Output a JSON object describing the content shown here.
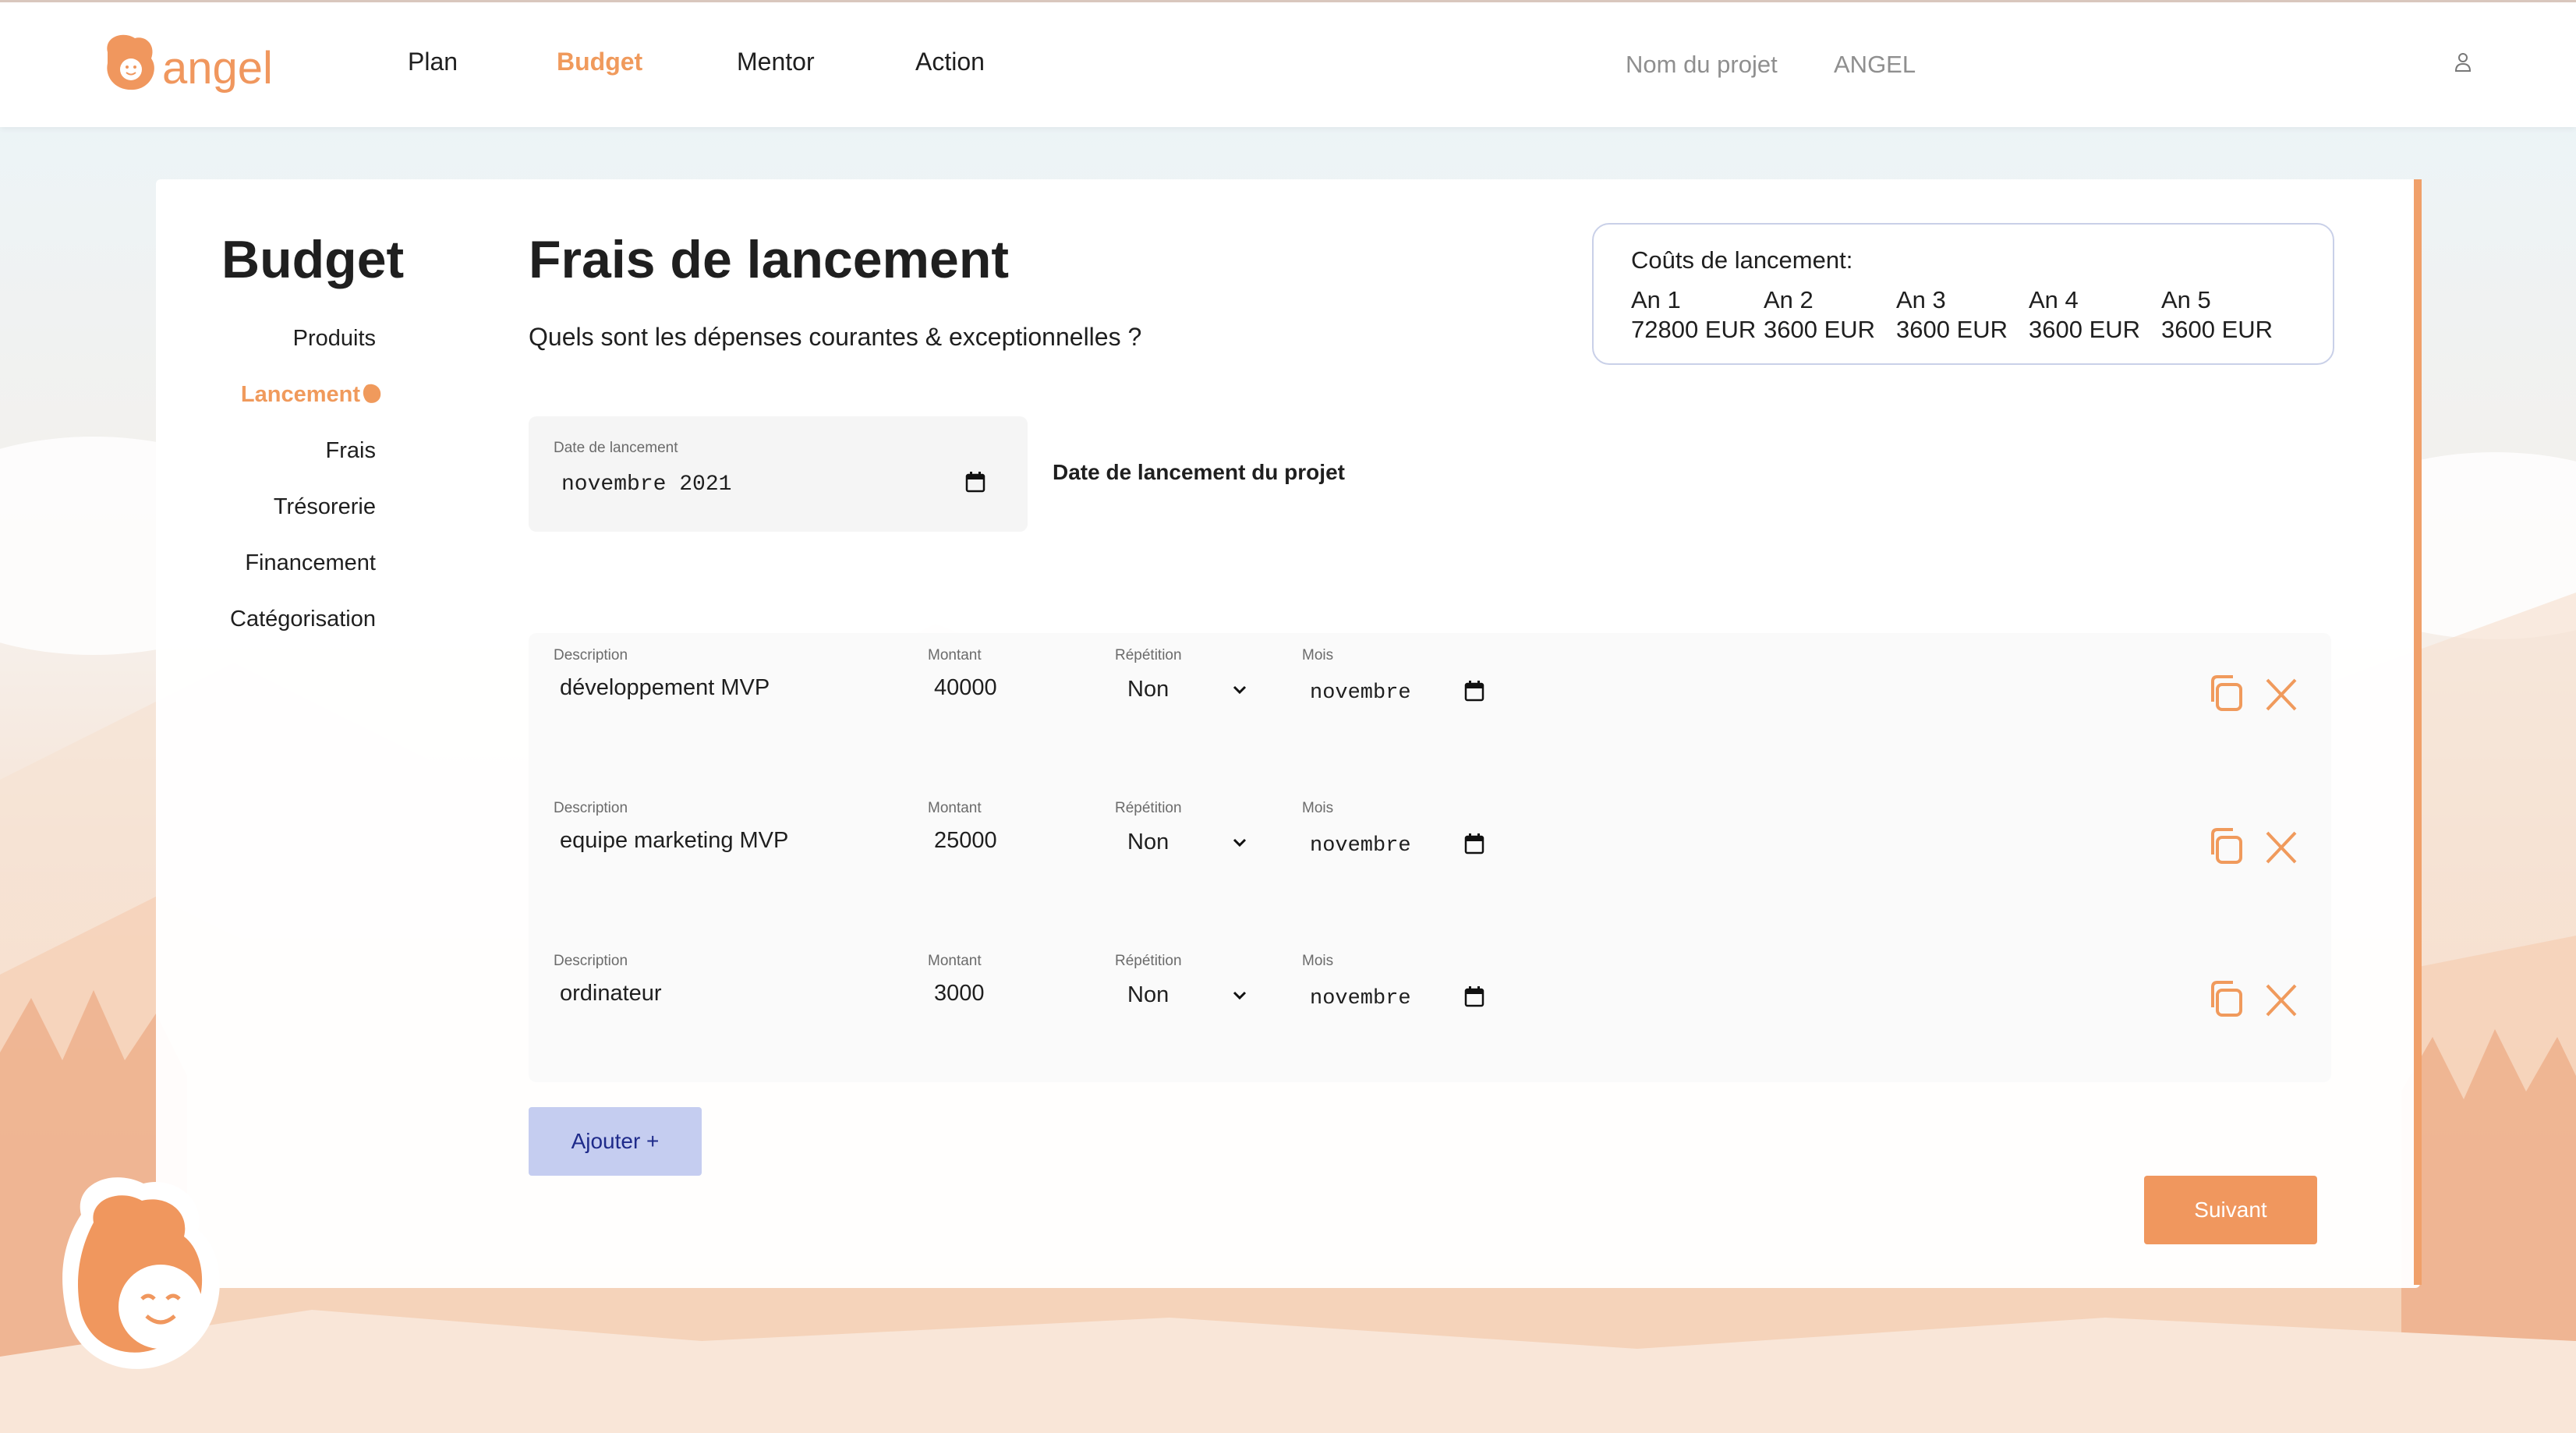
{
  "header": {
    "logo_text": "angel",
    "nav": [
      {
        "label": "Plan"
      },
      {
        "label": "Budget"
      },
      {
        "label": "Mentor"
      },
      {
        "label": "Action"
      }
    ],
    "project_label": "Nom du projet",
    "project_name": "ANGEL",
    "user_icon": "user-icon"
  },
  "sidebar": {
    "title": "Budget",
    "items": [
      {
        "label": "Produits"
      },
      {
        "label": "Lancement"
      },
      {
        "label": "Frais"
      },
      {
        "label": "Trésorerie"
      },
      {
        "label": "Financement"
      },
      {
        "label": "Catégorisation"
      }
    ]
  },
  "main": {
    "title": "Frais de lancement",
    "subtitle": "Quels sont les dépenses courantes & exceptionnelles ?"
  },
  "summary": {
    "title": "Coûts de lancement:",
    "years": [
      {
        "label": "An 1",
        "value": "72800 EUR"
      },
      {
        "label": "An 2",
        "value": "3600 EUR"
      },
      {
        "label": "An 3",
        "value": "3600 EUR"
      },
      {
        "label": "An 4",
        "value": "3600 EUR"
      },
      {
        "label": "An 5",
        "value": "3600 EUR"
      }
    ]
  },
  "launch_date": {
    "label": "Date de lancement",
    "value": "novembre  2021",
    "description": "Date de lancement du projet"
  },
  "columns": {
    "description": "Description",
    "amount": "Montant",
    "repetition": "Répétition",
    "month": "Mois"
  },
  "expenses": [
    {
      "description": "développement MVP",
      "amount": "40000",
      "repetition": "Non",
      "month": "novembre"
    },
    {
      "description": "equipe marketing MVP",
      "amount": "25000",
      "repetition": "Non",
      "month": "novembre"
    },
    {
      "description": "ordinateur",
      "amount": "3000",
      "repetition": "Non",
      "month": "novembre"
    }
  ],
  "buttons": {
    "add": "Ajouter +",
    "next": "Suivant"
  },
  "colors": {
    "accent": "#f09a5c",
    "add_button": "#c5cdf0",
    "next_button": "#f0975e"
  }
}
